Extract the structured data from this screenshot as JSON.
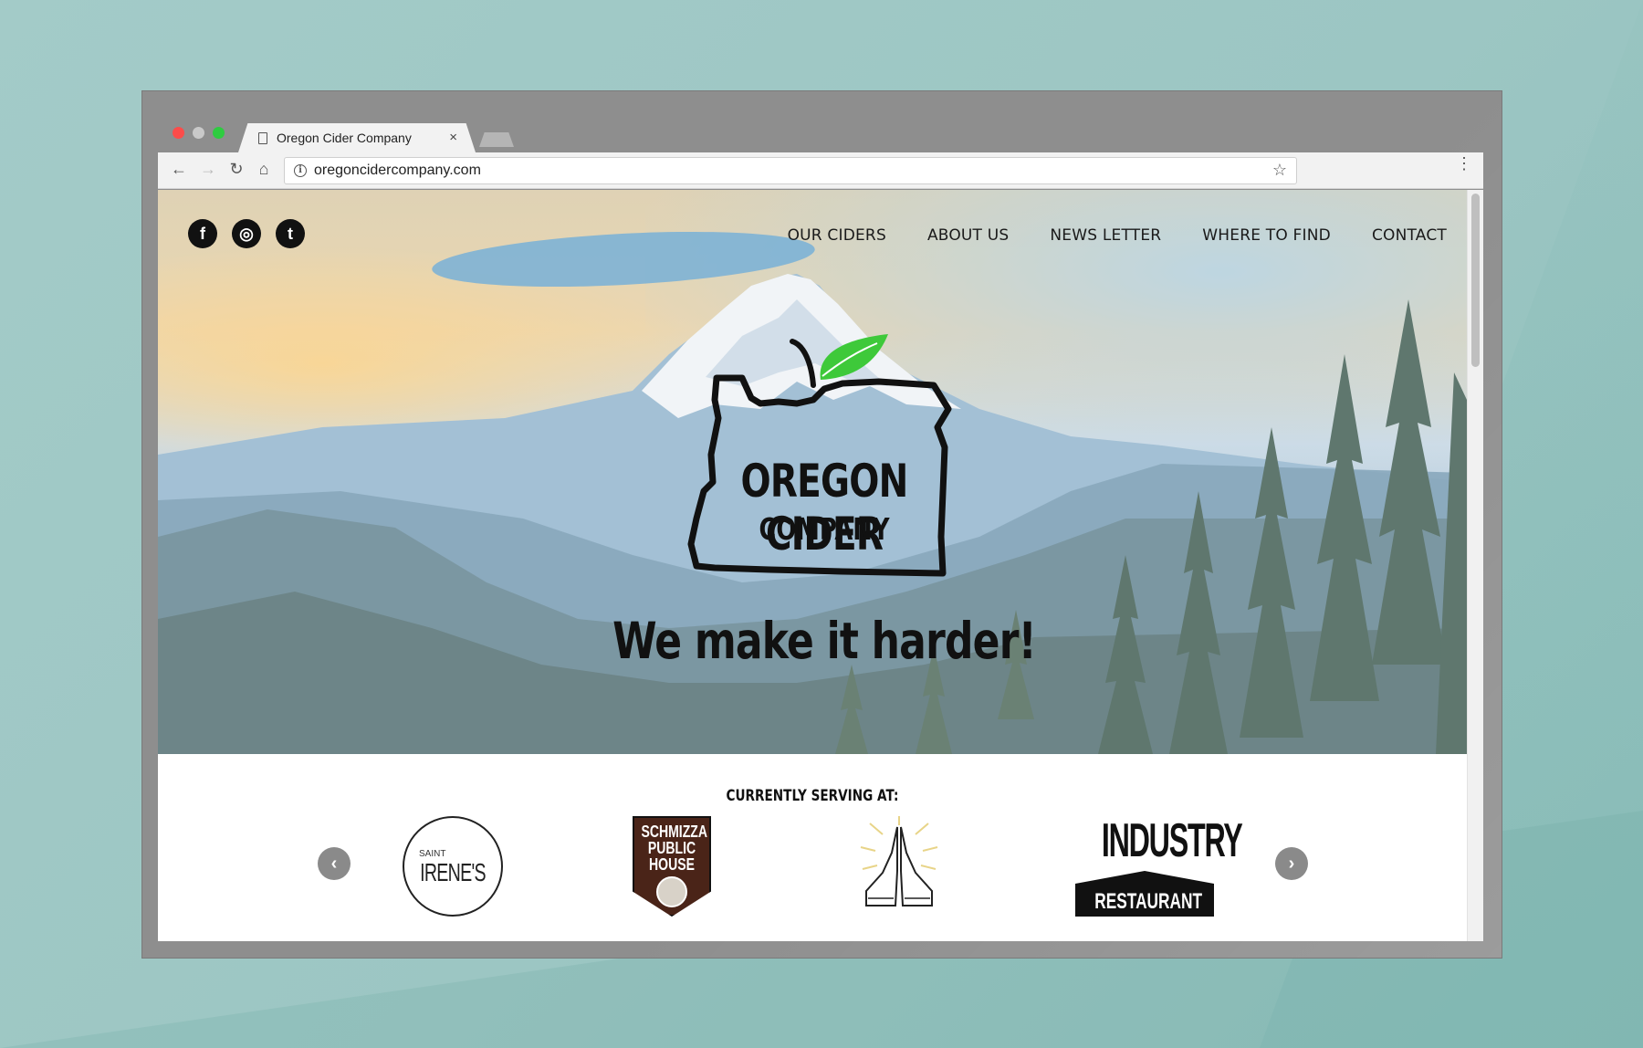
{
  "browser": {
    "tab_title": "Oregon Cider Company",
    "tab_close": "×",
    "url": "oregoncidercompany.com",
    "nav": {
      "back": "←",
      "forward": "→",
      "reload": "↻",
      "home": "⌂",
      "star": "☆",
      "menu": "⋮"
    },
    "info_icon": "i"
  },
  "site": {
    "socials": [
      {
        "icon": "facebook-icon",
        "glyph": "f"
      },
      {
        "icon": "instagram-icon",
        "glyph": "◎"
      },
      {
        "icon": "twitter-icon",
        "glyph": "t"
      }
    ],
    "nav": [
      "OUR CIDERS",
      "ABOUT US",
      "NEWS LETTER",
      "WHERE TO FIND",
      "CONTACT"
    ],
    "logo": {
      "line1": "OREGON CIDER",
      "line2": "COMPANY",
      "leaf_color": "#3ec93a"
    },
    "tagline": "We make it harder!",
    "serving": {
      "title": "CURRENTLY SERVING AT:",
      "prev": "‹",
      "next": "›",
      "venues": [
        {
          "name_small": "SAINT",
          "name_big": "IRENE'S"
        },
        {
          "name": "SCHMIZZA PUBLIC HOUSE"
        },
        {
          "name": "praying-hands-logo"
        },
        {
          "top": "INDUSTRY",
          "bottom": "RESTAURANT"
        }
      ]
    }
  }
}
